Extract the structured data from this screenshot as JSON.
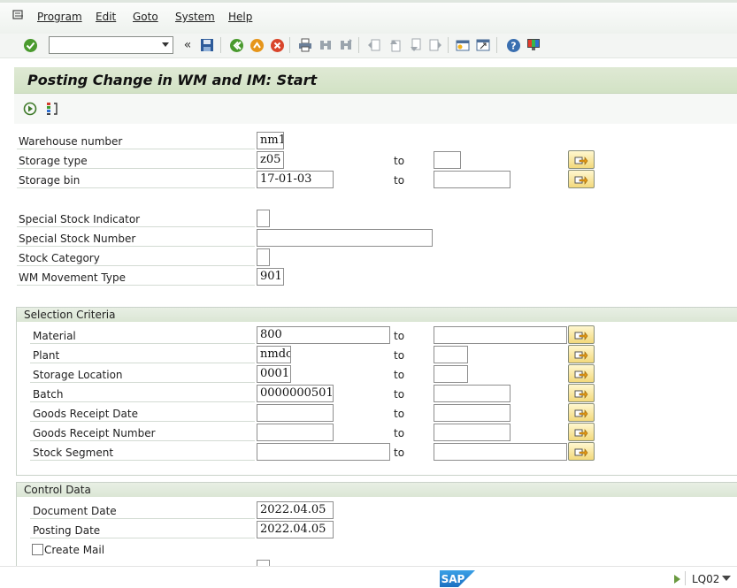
{
  "menu": {
    "items": [
      "Program",
      "Edit",
      "Goto",
      "System",
      "Help"
    ]
  },
  "toolbar": {
    "command_field_value": "",
    "icons": [
      "enter-icon",
      "save-icon",
      "back-icon",
      "exit-icon",
      "cancel-icon",
      "print-icon",
      "find-icon",
      "find-next-icon",
      "first-page-icon",
      "previous-page-icon",
      "next-page-icon",
      "last-page-icon",
      "create-session-icon",
      "shortcut-icon",
      "help-icon",
      "customize-layout-icon"
    ]
  },
  "title": "Posting Change in WM and IM: Start",
  "app_toolbar": {
    "icons": [
      "execute-icon",
      "variant-icon"
    ]
  },
  "fields": {
    "warehouse_number": {
      "label": "Warehouse number",
      "value": "nm1"
    },
    "storage_type": {
      "label": "Storage type",
      "value": "z05",
      "to_label": "to",
      "to_value": ""
    },
    "storage_bin": {
      "label": "Storage bin",
      "value": "17-01-03",
      "to_label": "to",
      "to_value": ""
    },
    "special_stock_indicator": {
      "label": "Special Stock Indicator",
      "value": ""
    },
    "special_stock_number": {
      "label": "Special Stock Number",
      "value": ""
    },
    "stock_category": {
      "label": "Stock Category",
      "value": ""
    },
    "wm_movement_type": {
      "label": "WM Movement Type",
      "value": "901"
    }
  },
  "selection_criteria": {
    "title": "Selection Criteria",
    "rows": [
      {
        "label": "Material",
        "value": "800",
        "to_label": "to",
        "to_value": ""
      },
      {
        "label": "Plant",
        "value": "nmdc",
        "to_label": "to",
        "to_value": ""
      },
      {
        "label": "Storage Location",
        "value": "0001",
        "to_label": "to",
        "to_value": ""
      },
      {
        "label": "Batch",
        "value": "0000000501",
        "to_label": "to",
        "to_value": ""
      },
      {
        "label": "Goods Receipt Date",
        "value": "",
        "to_label": "to",
        "to_value": ""
      },
      {
        "label": "Goods Receipt Number",
        "value": "",
        "to_label": "to",
        "to_value": ""
      },
      {
        "label": "Stock Segment",
        "value": "",
        "to_label": "to",
        "to_value": ""
      }
    ]
  },
  "control_data": {
    "title": "Control Data",
    "document_date": {
      "label": "Document Date",
      "value": "2022.04.05"
    },
    "posting_date": {
      "label": "Posting Date",
      "value": "2022.04.05"
    },
    "create_mail": {
      "label": "Create Mail",
      "checked": false
    }
  },
  "status": {
    "logo_text": "SAP",
    "transaction_code": "LQ02"
  }
}
